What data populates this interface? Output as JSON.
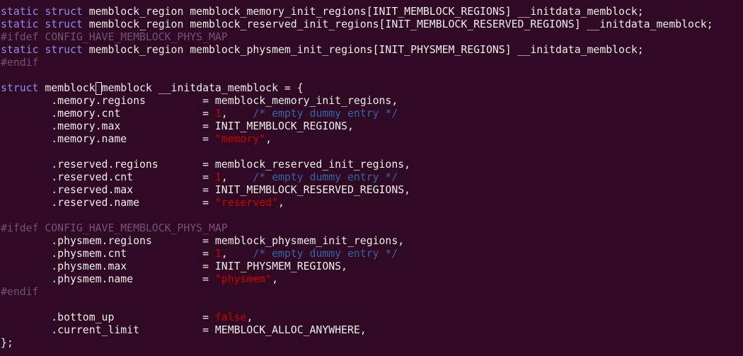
{
  "colors": {
    "background": "#300a24",
    "text": "#eeeeec",
    "keyword": "#8c8cf2",
    "preprocessor": "#75507b",
    "string": "#cc0000",
    "comment": "#3465a4"
  },
  "editor": {
    "cursor_line": 6,
    "cursor_col": 15,
    "lines": [
      [
        {
          "t": "kw",
          "v": "static"
        },
        {
          "t": "p",
          "v": " "
        },
        {
          "t": "kw",
          "v": "struct"
        },
        {
          "t": "p",
          "v": " memblock_region memblock_memory_init_regions[INIT_MEMBLOCK_REGIONS] __initdata_memblock;"
        }
      ],
      [
        {
          "t": "kw",
          "v": "static"
        },
        {
          "t": "p",
          "v": " "
        },
        {
          "t": "kw",
          "v": "struct"
        },
        {
          "t": "p",
          "v": " memblock_region memblock_reserved_init_regions[INIT_MEMBLOCK_RESERVED_REGIONS] __initdata_memblock;"
        }
      ],
      [
        {
          "t": "pre",
          "v": "#ifdef CONFIG_HAVE_MEMBLOCK_PHYS_MAP"
        }
      ],
      [
        {
          "t": "kw",
          "v": "static"
        },
        {
          "t": "p",
          "v": " "
        },
        {
          "t": "kw",
          "v": "struct"
        },
        {
          "t": "p",
          "v": " memblock_region memblock_physmem_init_regions[INIT_PHYSMEM_REGIONS] __initdata_memblock;"
        }
      ],
      [
        {
          "t": "pre",
          "v": "#endif"
        }
      ],
      [],
      [
        {
          "t": "kw",
          "v": "struct"
        },
        {
          "t": "p",
          "v": " memblock memblock __initdata_memblock = {"
        }
      ],
      [
        {
          "t": "p",
          "v": "        .memory.regions         = memblock_memory_init_regions,"
        }
      ],
      [
        {
          "t": "p",
          "v": "        .memory.cnt             = "
        },
        {
          "t": "num",
          "v": "1"
        },
        {
          "t": "p",
          "v": ",    "
        },
        {
          "t": "com",
          "v": "/* empty dummy entry */"
        }
      ],
      [
        {
          "t": "p",
          "v": "        .memory.max             = INIT_MEMBLOCK_REGIONS,"
        }
      ],
      [
        {
          "t": "p",
          "v": "        .memory.name            = "
        },
        {
          "t": "str",
          "v": "\"memory\""
        },
        {
          "t": "p",
          "v": ","
        }
      ],
      [],
      [
        {
          "t": "p",
          "v": "        .reserved.regions       = memblock_reserved_init_regions,"
        }
      ],
      [
        {
          "t": "p",
          "v": "        .reserved.cnt           = "
        },
        {
          "t": "num",
          "v": "1"
        },
        {
          "t": "p",
          "v": ",    "
        },
        {
          "t": "com",
          "v": "/* empty dummy entry */"
        }
      ],
      [
        {
          "t": "p",
          "v": "        .reserved.max           = INIT_MEMBLOCK_RESERVED_REGIONS,"
        }
      ],
      [
        {
          "t": "p",
          "v": "        .reserved.name          = "
        },
        {
          "t": "str",
          "v": "\"reserved\""
        },
        {
          "t": "p",
          "v": ","
        }
      ],
      [],
      [
        {
          "t": "pre",
          "v": "#ifdef CONFIG_HAVE_MEMBLOCK_PHYS_MAP"
        }
      ],
      [
        {
          "t": "p",
          "v": "        .physmem.regions        = memblock_physmem_init_regions,"
        }
      ],
      [
        {
          "t": "p",
          "v": "        .physmem.cnt            = "
        },
        {
          "t": "num",
          "v": "1"
        },
        {
          "t": "p",
          "v": ",    "
        },
        {
          "t": "com",
          "v": "/* empty dummy entry */"
        }
      ],
      [
        {
          "t": "p",
          "v": "        .physmem.max            = INIT_PHYSMEM_REGIONS,"
        }
      ],
      [
        {
          "t": "p",
          "v": "        .physmem.name           = "
        },
        {
          "t": "str",
          "v": "\"physmem\""
        },
        {
          "t": "p",
          "v": ","
        }
      ],
      [
        {
          "t": "pre",
          "v": "#endif"
        }
      ],
      [],
      [
        {
          "t": "p",
          "v": "        .bottom_up              = "
        },
        {
          "t": "str",
          "v": "false"
        },
        {
          "t": "p",
          "v": ","
        }
      ],
      [
        {
          "t": "p",
          "v": "        .current_limit          = MEMBLOCK_ALLOC_ANYWHERE,"
        }
      ],
      [
        {
          "t": "p",
          "v": "};"
        }
      ]
    ]
  }
}
